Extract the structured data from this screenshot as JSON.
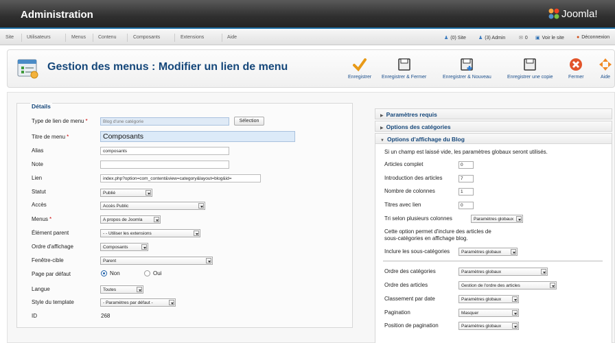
{
  "header": {
    "title": "Administration",
    "logo_text": "Joomla!"
  },
  "menubar": {
    "items": [
      "Site",
      "Utilisateurs",
      "Menus",
      "Contenu",
      "Composants",
      "Extensions",
      "Aide"
    ]
  },
  "status": {
    "site": "(0) Site",
    "admin": "(3) Admin",
    "messages": "0",
    "view_site": "Voir le site",
    "logout": "Déconnexion"
  },
  "toolbar": {
    "page_title": "Gestion des menus : Modifier un lien de menu",
    "buttons": [
      "Enregistrer",
      "Enregistrer & Fermer",
      "Enregistrer & Nouveau",
      "Enregistrer une copie",
      "Fermer",
      "Aide"
    ]
  },
  "details": {
    "legend": "Détails",
    "type_label": "Type de lien de menu",
    "type_value": "Blog d'une catégorie",
    "select_button": "Sélection",
    "title_label": "Titre de menu",
    "title_value": "Composants",
    "alias_label": "Alias",
    "alias_value": "composants",
    "note_label": "Note",
    "note_value": "",
    "link_label": "Lien",
    "link_value": "index.php?option=com_content&view=category&layout=blog&id=",
    "status_label": "Statut",
    "status_value": "Publié",
    "access_label": "Accès",
    "access_value": "Accès Public",
    "menus_label": "Menus",
    "menus_value": "A propos de Joomla",
    "parent_label": "Élément parent",
    "parent_value": "- - Utiliser les extensions",
    "order_label": "Ordre d'affichage",
    "order_value": "Composants",
    "window_label": "Fenêtre-cible",
    "window_value": "Parent",
    "default_label": "Page par défaut",
    "default_no": "Non",
    "default_yes": "Oui",
    "language_label": "Langue",
    "language_value": "Toutes",
    "style_label": "Style du template",
    "style_value": "- Paramètres par défaut -",
    "id_label": "ID",
    "id_value": "268"
  },
  "right": {
    "required": "Paramètres requis",
    "category_options": "Options des catégories",
    "blog_options": "Options d'affichage du Blog",
    "note": "Si un champ est laissé vide, les paramètres globaux seront utilisés.",
    "leading_label": "Articles complet",
    "leading_value": "0",
    "intro_label": "Introduction des articles",
    "intro_value": "7",
    "columns_label": "Nombre de colonnes",
    "columns_value": "1",
    "links_label": "Titres avec lien",
    "links_value": "0",
    "multi_label": "Tri selon plusieurs colonnes",
    "multi_value": "Paramètres globaux",
    "info_line1": "Cette option permet d'inclure des articles de",
    "info_line2": "sous-catégories en affichage blog.",
    "subcat_label": "Inclure les sous-catégories",
    "subcat_value": "Paramètres globaux",
    "catorder_label": "Ordre des catégories",
    "catorder_value": "Paramètres globaux",
    "artorder_label": "Ordre des articles",
    "artorder_value": "Gestion de l'ordre des articles",
    "date_label": "Classement par date",
    "date_value": "Paramètres globaux",
    "pagination_label": "Pagination",
    "pagination_value": "Masquer",
    "pagpos_label": "Position de pagination",
    "pagpos_value": "Paramètres globaux"
  }
}
